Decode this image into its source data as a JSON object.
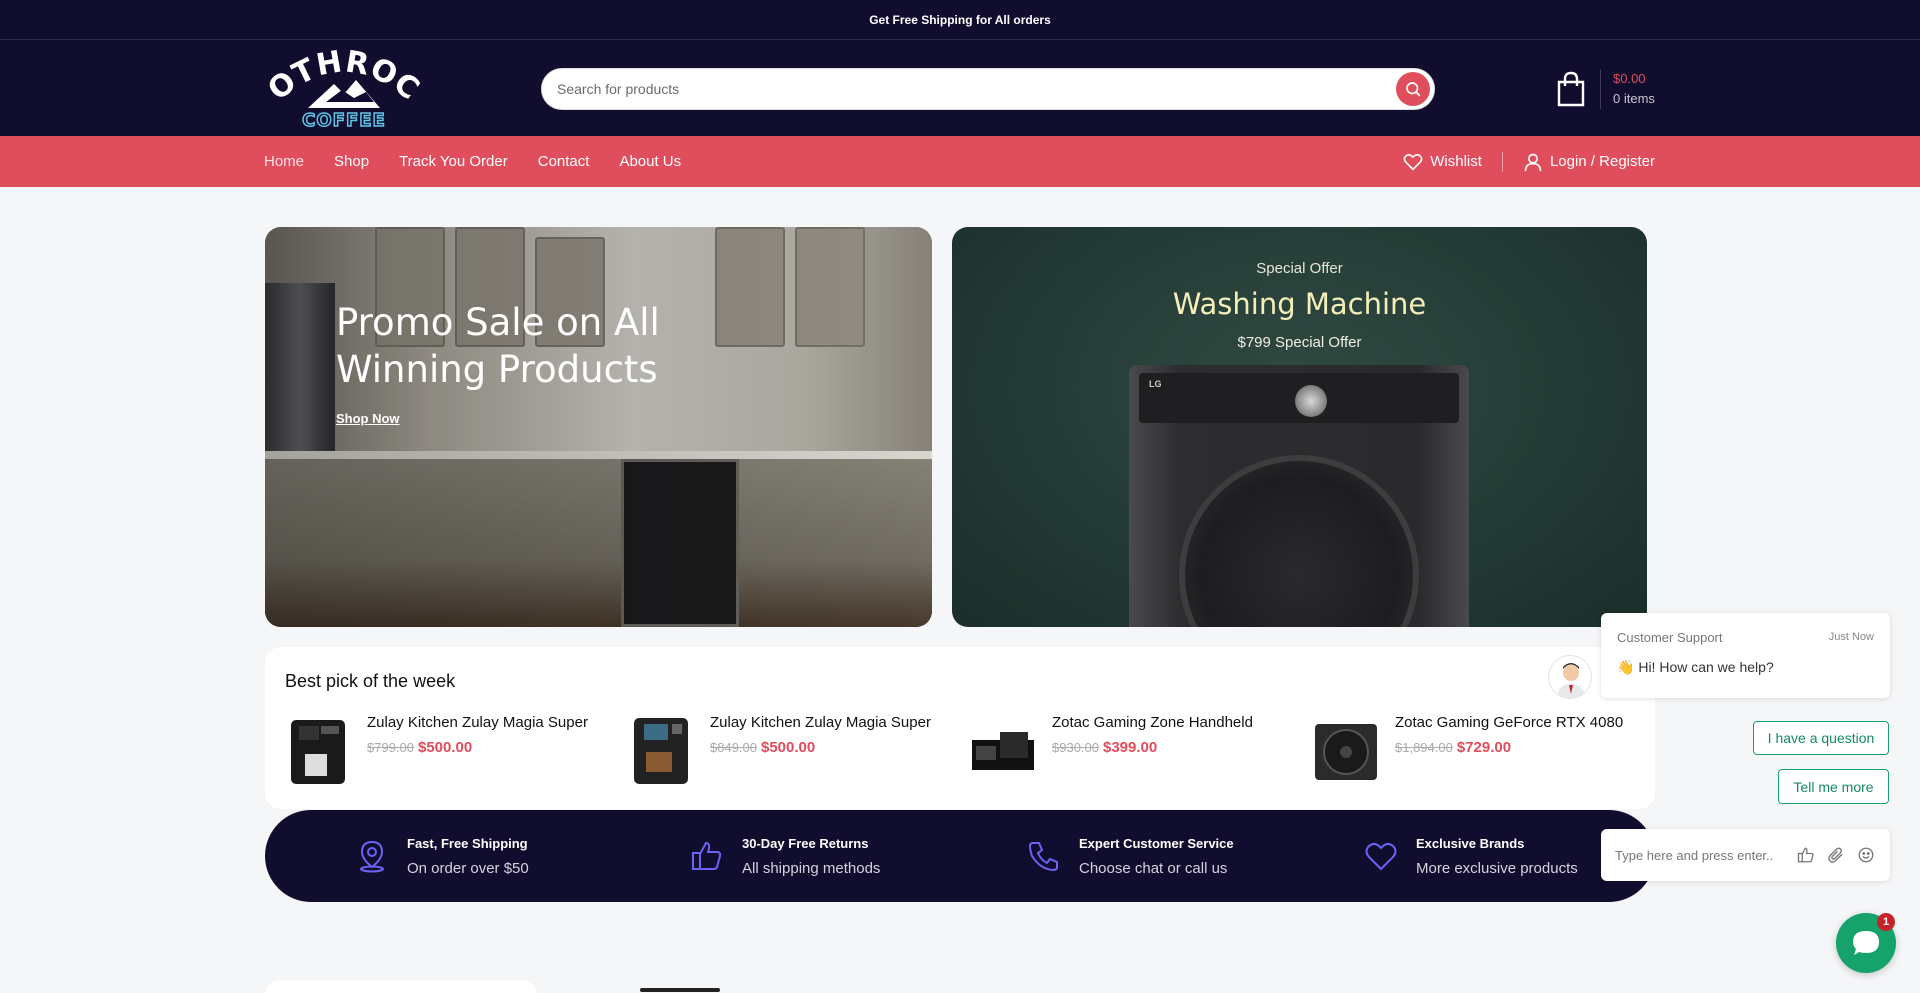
{
  "announcement": "Get Free Shipping for All orders",
  "brand": {
    "logo_text_top": "ROTHROCK",
    "logo_text_bottom": "COFFEE",
    "accent": "#e04d5c",
    "dark": "#110d2e"
  },
  "search": {
    "placeholder": "Search for products"
  },
  "cart": {
    "total": "$0.00",
    "items": "0 items"
  },
  "nav": {
    "links": [
      "Home",
      "Shop",
      "Track You Order",
      "Contact",
      "About Us"
    ],
    "wishlist": "Wishlist",
    "login": "Login / Register"
  },
  "promo": {
    "title": "Promo Sale on All Winning Products",
    "cta": "Shop Now"
  },
  "offer": {
    "subtitle": "Special Offer",
    "title": "Washing Machine",
    "price": "$799 Special Offer",
    "product_brand": "LG"
  },
  "best_pick": {
    "title": "Best pick of the week",
    "products": [
      {
        "name": "Zulay Kitchen Zulay Magia Super",
        "old_price": "$799.00",
        "price": "$500.00"
      },
      {
        "name": "Zulay Kitchen Zulay Magia Super",
        "old_price": "$849.00",
        "price": "$500.00"
      },
      {
        "name": "Zotac Gaming Zone Handheld",
        "old_price": "$930.00",
        "price": "$399.00"
      },
      {
        "name": "Zotac Gaming GeForce RTX 4080",
        "old_price": "$1,894.00",
        "price": "$729.00"
      }
    ]
  },
  "features": [
    {
      "title": "Fast, Free Shipping",
      "subtitle": "On order over $50",
      "icon": "location-pin-icon"
    },
    {
      "title": "30-Day Free Returns",
      "subtitle": "All shipping methods",
      "icon": "thumbs-up-icon"
    },
    {
      "title": "Expert Customer Service",
      "subtitle": "Choose chat or call us",
      "icon": "phone-icon"
    },
    {
      "title": "Exclusive Brands",
      "subtitle": "More exclusive products",
      "icon": "heart-icon"
    }
  ],
  "chat": {
    "header": "Customer Support",
    "time": "Just Now",
    "emoji": "👋",
    "message": "Hi! How can we help?",
    "buttons": [
      "I have a question",
      "Tell me more"
    ],
    "input_placeholder": "Type here and press enter..",
    "badge": "1",
    "accent": "#16a36b"
  }
}
